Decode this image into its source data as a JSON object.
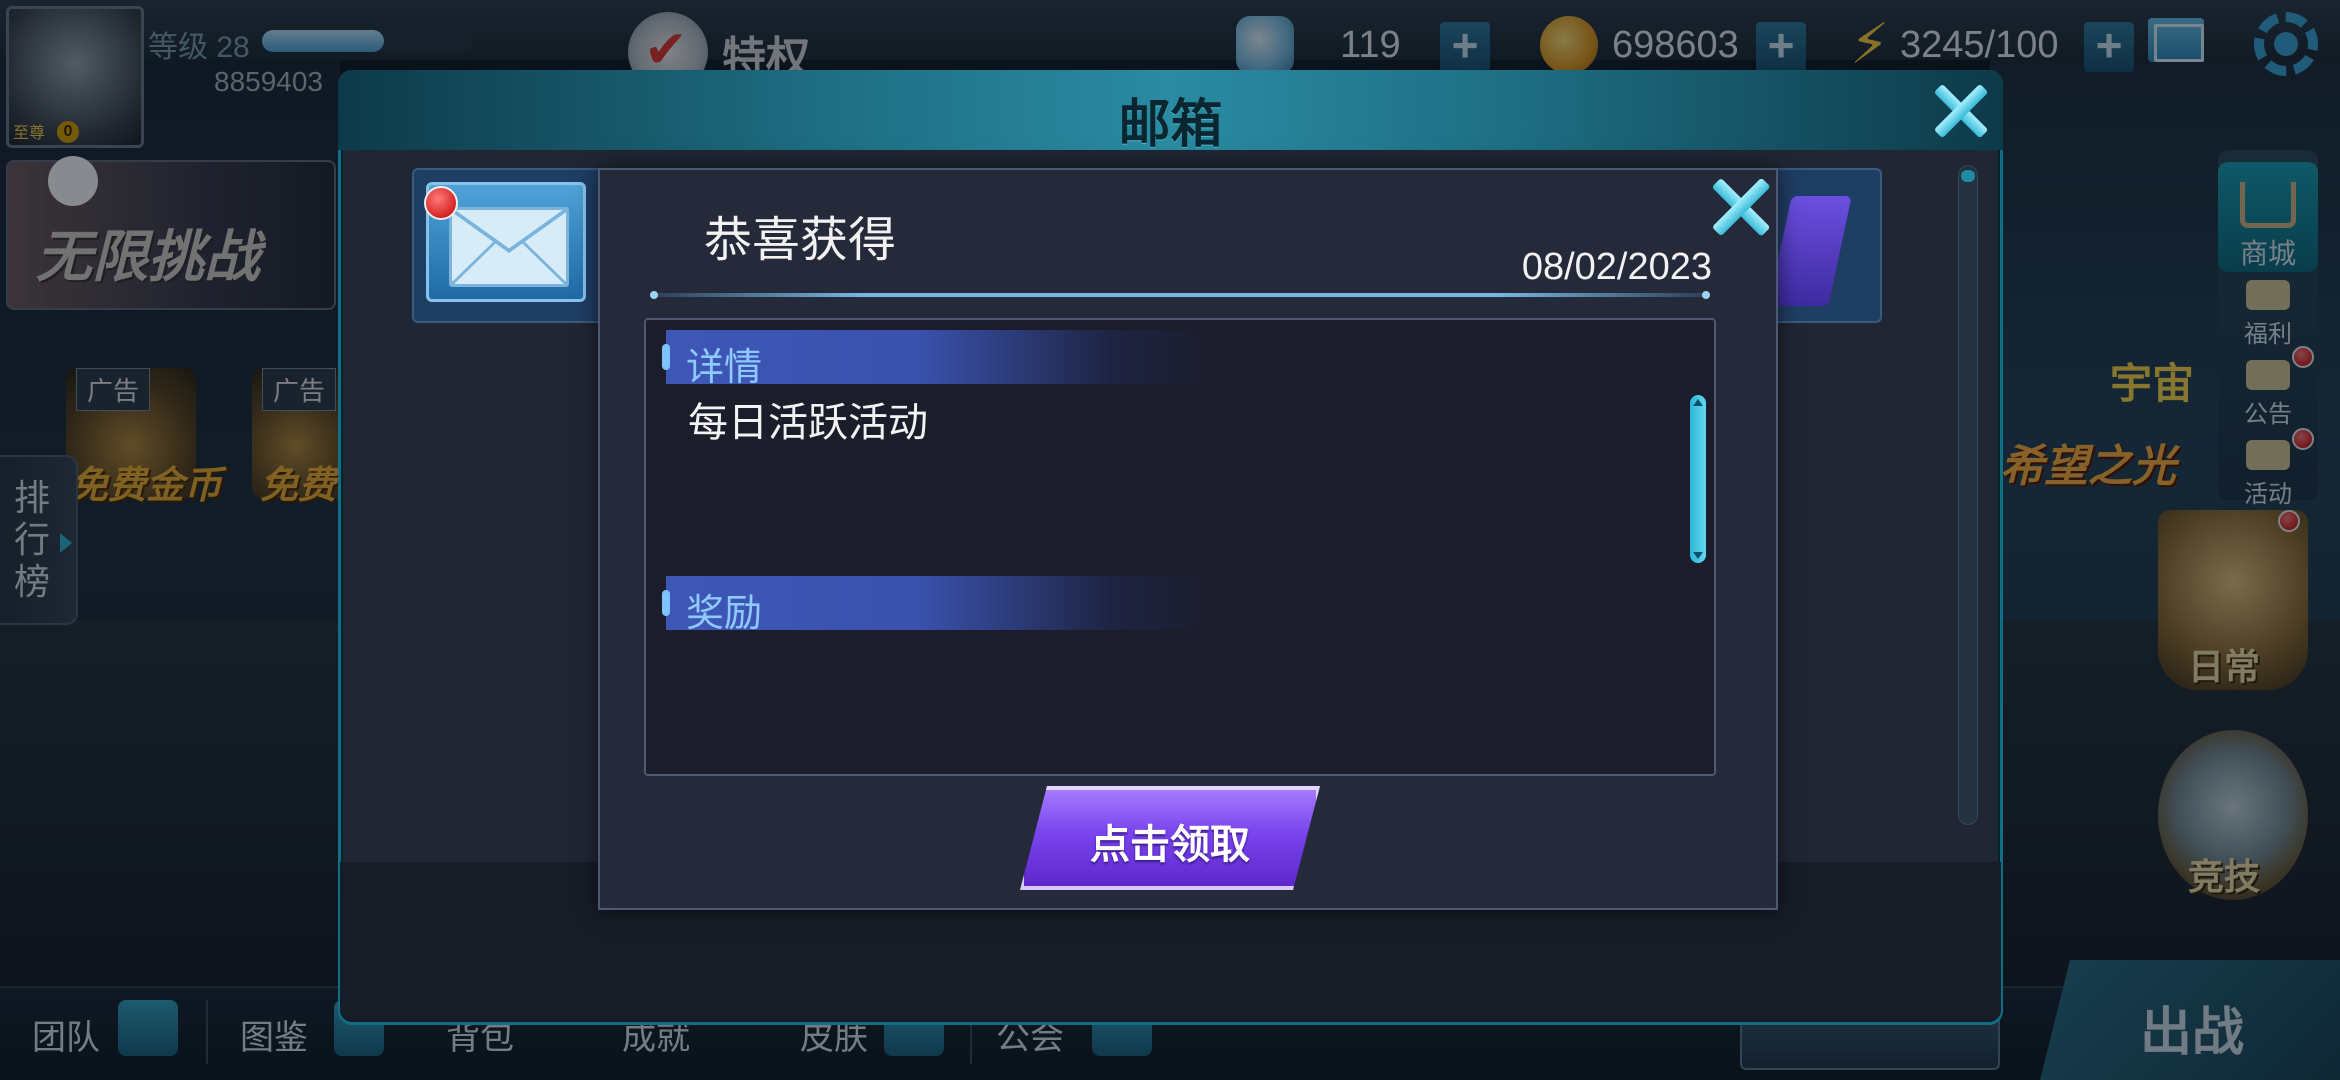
{
  "hud": {
    "level_label": "等级",
    "level": "28",
    "level_progress": 0.58,
    "player_id": "8859403",
    "avatar_tag": "至尊",
    "avatar_badge": "0",
    "privilege_label": "特权",
    "diamonds": "119",
    "gold": "698603",
    "energy": "3245/100"
  },
  "left_panel": {
    "challenge_label": "无限挑战",
    "ads": [
      {
        "tag": "广告",
        "caption": "免费金币"
      },
      {
        "tag": "广告",
        "caption": "免费"
      }
    ],
    "leaderboard_label": "排行榜"
  },
  "right_menu": {
    "shop": "商城",
    "welfare": "福利",
    "notice": "公告",
    "event": "活动",
    "daily": "日常",
    "arena": "竞技",
    "hope_text": "希望之光",
    "cosmos_text": "宇宙"
  },
  "bottom_bar": {
    "items": [
      "团队",
      "图鉴",
      "背包",
      "成就",
      "皮肤",
      "公会"
    ],
    "battle": "出战"
  },
  "mailbox": {
    "title": "邮箱"
  },
  "reward_dialog": {
    "title": "恭喜获得",
    "date": "08/02/2023",
    "details_label": "详情",
    "details_text": "每日活跃活动",
    "rewards_label": "奖励",
    "claim_button": "点击领取"
  },
  "colors": {
    "accent_cyan": "#39bad7",
    "claim_purple": "#7a44ee",
    "section_blue": "#3e56b6",
    "notification_red": "#c30000"
  }
}
